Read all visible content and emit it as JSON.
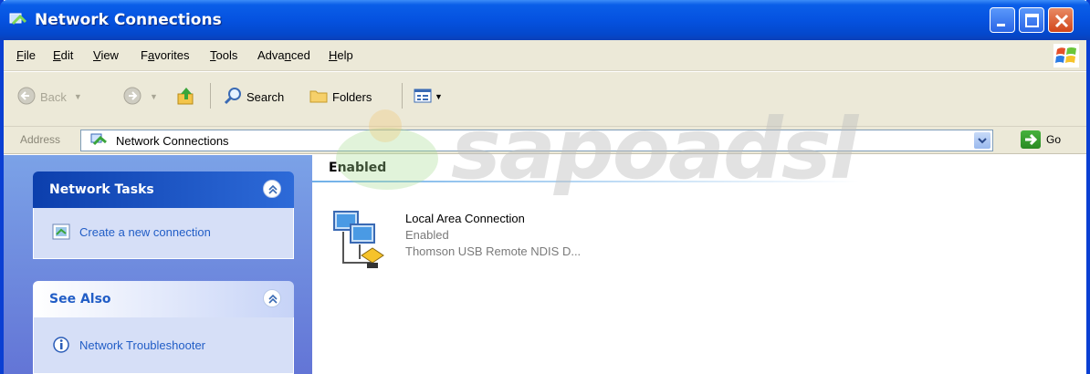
{
  "window": {
    "title": "Network Connections",
    "colors": {
      "titlebar": "#0552e0",
      "close": "#d2461a",
      "link": "#215dc6"
    }
  },
  "menu": [
    {
      "label": "File",
      "key": "F"
    },
    {
      "label": "Edit",
      "key": "E"
    },
    {
      "label": "View",
      "key": "V"
    },
    {
      "label": "Favorites",
      "key": "a"
    },
    {
      "label": "Tools",
      "key": "T"
    },
    {
      "label": "Advanced",
      "key": "n"
    },
    {
      "label": "Help",
      "key": "H"
    }
  ],
  "toolbar": {
    "back_label": "Back",
    "search_label": "Search",
    "folders_label": "Folders"
  },
  "address": {
    "label": "Address",
    "value": "Network Connections",
    "go_label": "Go"
  },
  "taskpane": {
    "network_tasks": {
      "title": "Network Tasks",
      "items": [
        {
          "label": "Create a new connection",
          "icon": "new-connection-icon"
        }
      ]
    },
    "see_also": {
      "title": "See Also",
      "items": [
        {
          "label": "Network Troubleshooter",
          "icon": "info-icon"
        }
      ]
    }
  },
  "content": {
    "group_title": "Enabled",
    "connections": [
      {
        "name": "Local Area Connection",
        "status": "Enabled",
        "device": "Thomson USB Remote NDIS D...",
        "icon": "lan-connection-icon"
      }
    ]
  },
  "watermark": {
    "text": "sapoadsl"
  }
}
